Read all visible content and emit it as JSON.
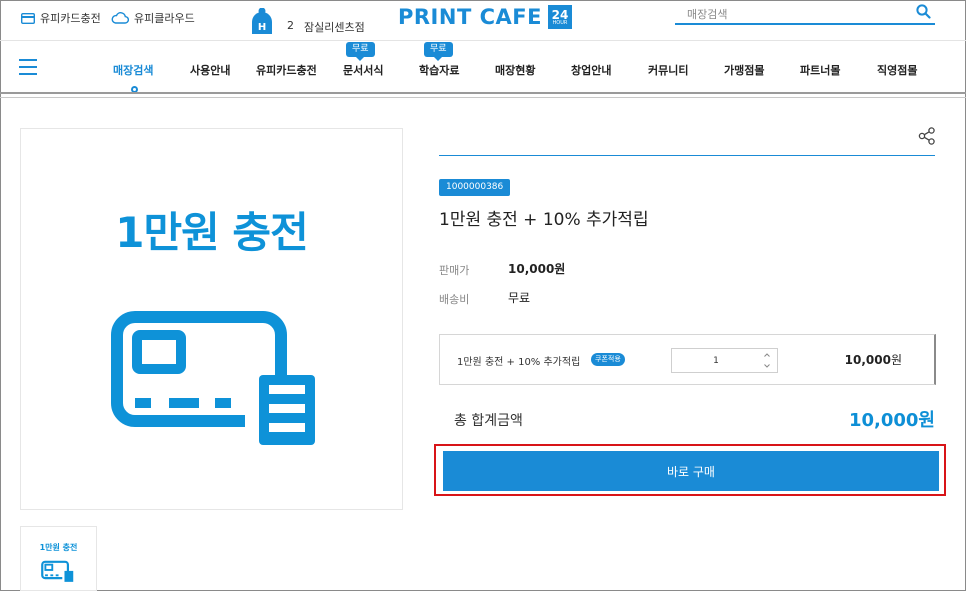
{
  "topbar": {
    "card_charge_label": "유피카드충전",
    "cloud_label": "유피클라우드",
    "store_badge_letter": "H",
    "store_number": "2",
    "store_name": "잠실리센츠점",
    "logo_text": "PRINT CAFE",
    "logo_badge_number": "24",
    "logo_badge_sub": "HOUR",
    "search_placeholder": "매장검색"
  },
  "nav": {
    "items": [
      {
        "label": "매장검색",
        "active": true
      },
      {
        "label": "사용안내"
      },
      {
        "label": "유피카드충전"
      },
      {
        "label": "문서서식",
        "badge": "무료"
      },
      {
        "label": "학습자료",
        "badge": "무료"
      },
      {
        "label": "매장현황"
      },
      {
        "label": "창업안내"
      },
      {
        "label": "커뮤니티"
      },
      {
        "label": "가맹점몰"
      },
      {
        "label": "파트너몰"
      },
      {
        "label": "직영점몰"
      }
    ]
  },
  "product": {
    "image_title": "1만원 충전",
    "thumb_title": "1만원 충전",
    "code": "1000000386",
    "title": "1만원 충전 + 10% 추가적립",
    "price_label": "판매가",
    "price_value": "10,000원",
    "shipping_label": "배송비",
    "shipping_value": "무료"
  },
  "option": {
    "name": "1만원 충전 + 10% 추가적립",
    "coupon_badge": "쿠폰적용",
    "quantity": "1",
    "price_number": "10,000",
    "price_unit": "원"
  },
  "total": {
    "label": "총 합계금액",
    "value": "10,000원"
  },
  "buy_button_label": "바로 구매",
  "colors": {
    "brand_blue": "#1a8bd6",
    "highlight_red": "#d81418"
  }
}
